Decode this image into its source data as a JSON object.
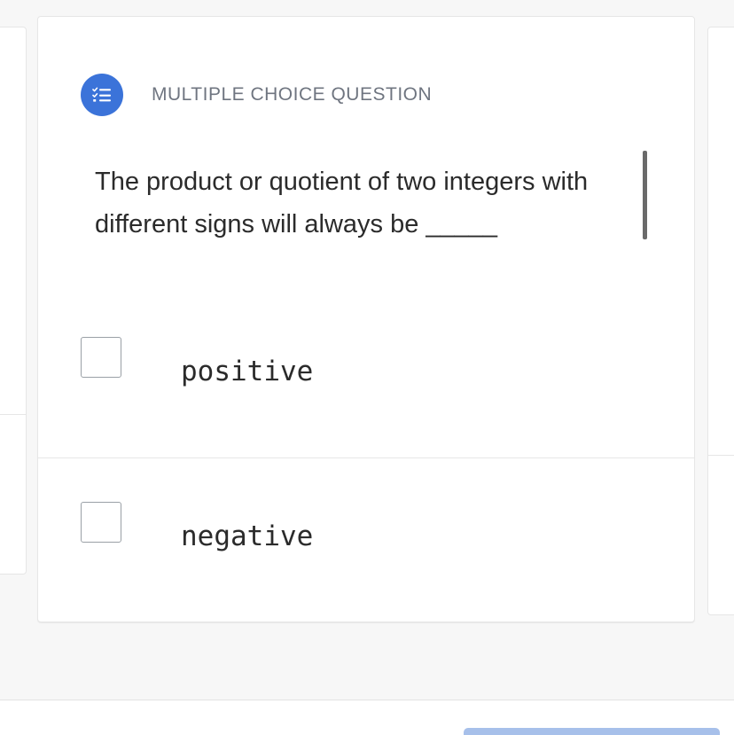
{
  "question": {
    "type_label": "MULTIPLE CHOICE QUESTION",
    "badge_icon": "checklist-icon",
    "badge_color": "#3b73d9",
    "text": "The product or quotient of two integers with different signs will always be _____"
  },
  "options": [
    {
      "label": "positive",
      "checked": false
    },
    {
      "label": "negative",
      "checked": false
    }
  ],
  "colors": {
    "page_background": "#f7f7f7",
    "card_background": "#ffffff",
    "submit_button": "#a7c0ea"
  }
}
